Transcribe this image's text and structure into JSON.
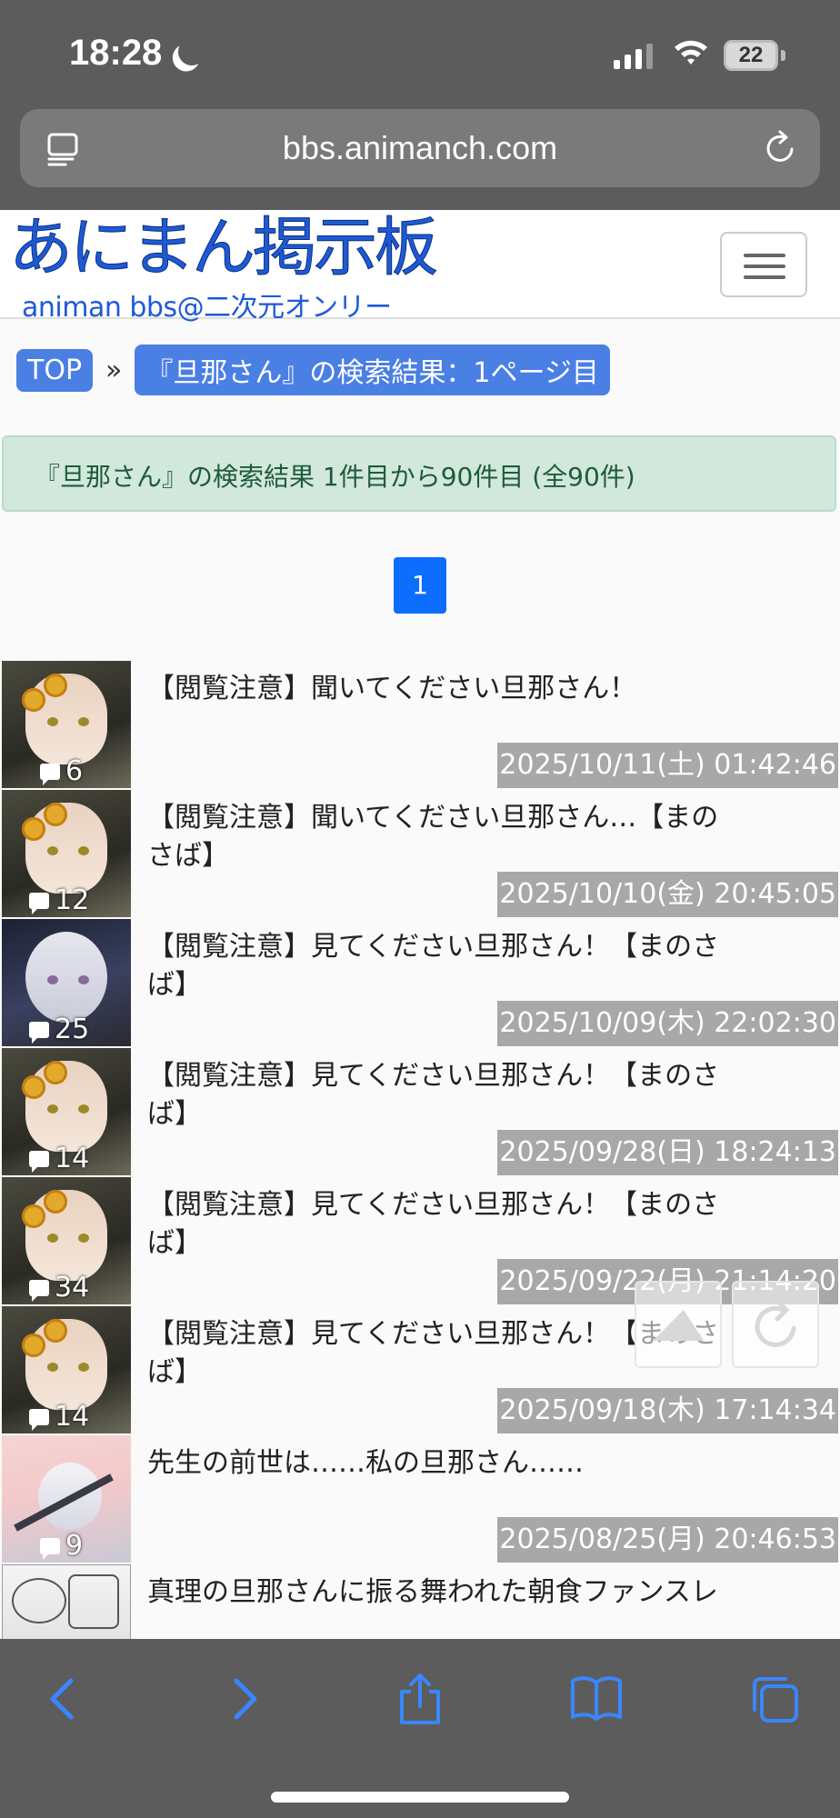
{
  "status_bar": {
    "time": "18:28",
    "battery": "22"
  },
  "url_bar": {
    "url": "bbs.animanch.com"
  },
  "site": {
    "logo_title": "あにまん掲示板",
    "logo_subtitle": "animan bbs@二次元オンリー"
  },
  "breadcrumb": {
    "top_label": "TOP",
    "separator": "»",
    "current": "『旦那さん』の検索結果：1ページ目"
  },
  "result_summary": "『旦那さん』の検索結果 1件目から90件目 (全90件)",
  "pagination": {
    "current_page": "1"
  },
  "threads": [
    {
      "title": "【閲覧注意】聞いてください旦那さん！",
      "count": "6",
      "date": "2025/10/11(土) 01:42:46"
    },
    {
      "title": "【閲覧注意】聞いてください旦那さん…【まのさば】",
      "count": "12",
      "date": "2025/10/10(金) 20:45:05"
    },
    {
      "title": "【閲覧注意】見てください旦那さん！【まのさば】",
      "count": "25",
      "date": "2025/10/09(木) 22:02:30"
    },
    {
      "title": "【閲覧注意】見てください旦那さん！【まのさば】",
      "count": "14",
      "date": "2025/09/28(日) 18:24:13"
    },
    {
      "title": "【閲覧注意】見てください旦那さん！【まのさば】",
      "count": "34",
      "date": "2025/09/22(月) 21:14:20"
    },
    {
      "title": "【閲覧注意】見てください旦那さん！【まのさば】",
      "count": "14",
      "date": "2025/09/18(木) 17:14:34"
    },
    {
      "title": "先生の前世は……私の旦那さん……",
      "count": "9",
      "date": "2025/08/25(月) 20:46:53"
    },
    {
      "title": "真理の旦那さんに振る舞われた朝食ファンスレ",
      "count": "",
      "date": ""
    }
  ],
  "icons": {
    "tabs": "tabs-icon",
    "reload": "reload-icon",
    "menu": "hamburger-menu-icon",
    "comment": "comment-bubble-icon",
    "back": "back-arrow-icon",
    "forward": "forward-arrow-icon",
    "share": "share-icon",
    "bookmarks": "bookmarks-icon",
    "tab_overview": "tab-overview-icon",
    "scroll_top": "scroll-to-top-icon",
    "refresh": "refresh-icon"
  },
  "colors": {
    "accent": "#4a7fe4",
    "pager": "#0d6efd",
    "result_bg": "#d2e8dd",
    "date_bg": "#a8a8a8",
    "toolbar_icon": "#3a86ff"
  }
}
